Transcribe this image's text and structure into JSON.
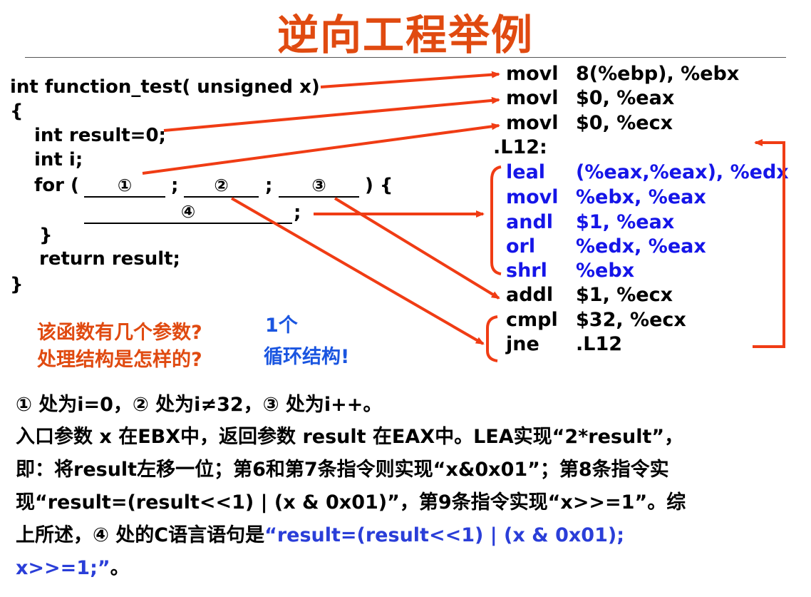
{
  "title": "逆向工程举例",
  "code": {
    "line1": "int function_test( unsigned x)",
    "line2": "{",
    "line3": "int result=0;",
    "line4": "int i;",
    "line5_for": "for (",
    "line5_semi": ";",
    "line5_end": ") {",
    "line6_semi": ";",
    "line7": "}",
    "line8": "return result;",
    "line9": "}",
    "blanks": [
      "①",
      "②",
      "③",
      "④"
    ]
  },
  "asm": [
    {
      "op": "movl",
      "args": "8(%ebp), %ebx",
      "highlight": false
    },
    {
      "op": "movl",
      "args": "$0, %eax",
      "highlight": false
    },
    {
      "op": "movl",
      "args": "$0, %ecx",
      "highlight": false
    },
    {
      "op": ".L12:",
      "args": "",
      "highlight": false
    },
    {
      "op": "leal",
      "args": "(%eax,%eax), %edx",
      "highlight": true
    },
    {
      "op": "movl",
      "args": "%ebx, %eax",
      "highlight": true
    },
    {
      "op": "andl",
      "args": "$1, %eax",
      "highlight": true
    },
    {
      "op": "orl",
      "args": "%edx, %eax",
      "highlight": true
    },
    {
      "op": "shrl",
      "args": "%ebx",
      "highlight": true
    },
    {
      "op": "addl",
      "args": "$1, %ecx",
      "highlight": false
    },
    {
      "op": "cmpl",
      "args": "$32, %ecx",
      "highlight": false
    },
    {
      "op": "jne",
      "args": ".L12",
      "highlight": false
    }
  ],
  "questions": {
    "q1": "该函数有几个参数?",
    "q2": "处理结构是怎样的?",
    "a1": "1个",
    "a2": "循环结构!"
  },
  "explanation": {
    "p1": "① 处为i=0，② 处为i≠32，③ 处为i++。",
    "p2": "入口参数 x 在EBX中，返回参数 result 在EAX中。LEA实现“2*result”，",
    "p3": "即：将result左移一位；第6和第7条指令则实现“x&0x01”；第8条指令实",
    "p4": "现“result=(result<<1) | (x & 0x01)”，第9条指令实现“x>>=1”。综",
    "p5_pre": "上所述，④ 处的C语言语句是",
    "p5_hl": "“result=(result<<1) | (x & 0x01);",
    "p6_hl": "x>>=1;”",
    "p6_post": "。"
  },
  "colors": {
    "title": "#e04a10",
    "arrow": "#f03c14",
    "blue_code": "#1515e8",
    "answer": "#1a55e0"
  }
}
